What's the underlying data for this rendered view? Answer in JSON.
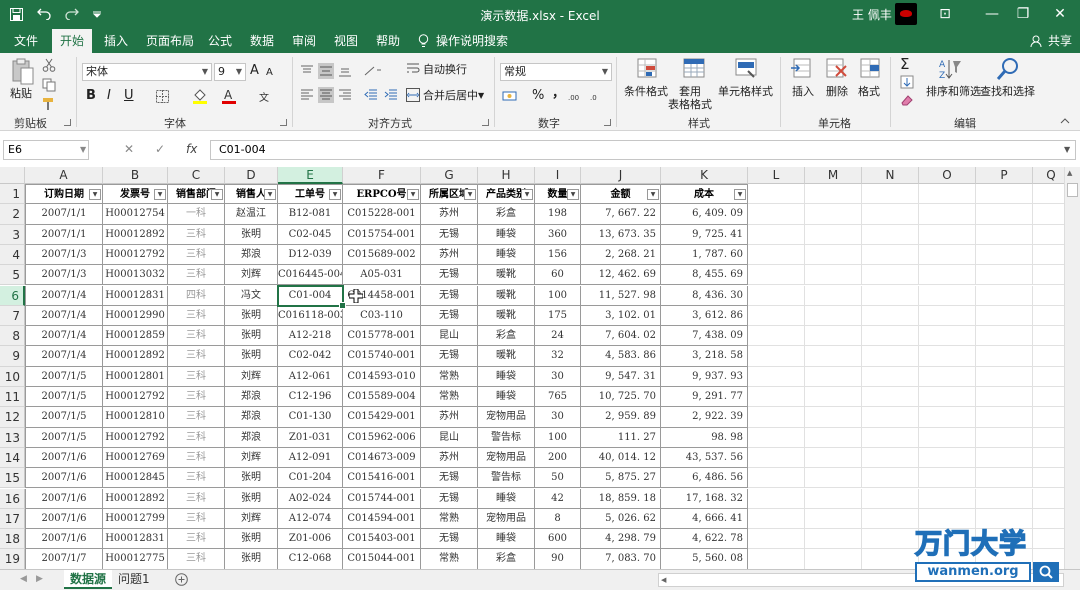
{
  "window": {
    "title": "演示数据.xlsx  -  Excel",
    "user": "王 佩丰",
    "buttons": {
      "restore_ribbon": "⊡",
      "minimize": "—",
      "maximize": "❐",
      "close": "✕"
    }
  },
  "qat": {
    "save_icon": "save-icon",
    "undo_icon": "undo-icon",
    "redo_icon": "redo-icon",
    "customize_icon": "qat-dropdown-icon"
  },
  "tabs": [
    {
      "label": "文件"
    },
    {
      "label": "开始"
    },
    {
      "label": "插入"
    },
    {
      "label": "页面布局"
    },
    {
      "label": "公式"
    },
    {
      "label": "数据"
    },
    {
      "label": "审阅"
    },
    {
      "label": "视图"
    },
    {
      "label": "帮助"
    }
  ],
  "tell_me": "操作说明搜索",
  "share": "共享",
  "ribbon": {
    "clipboard": {
      "label": "剪贴板",
      "paste": "粘贴"
    },
    "font": {
      "label": "字体",
      "name": "宋体",
      "size": "9",
      "bold": "B",
      "italic": "I",
      "underline": "U",
      "grow": "A",
      "shrink": "A"
    },
    "alignment": {
      "label": "对齐方式",
      "wrap": "自动换行",
      "merge": "合并后居中"
    },
    "number": {
      "label": "数字",
      "format": "常规",
      "percent": "%",
      "comma": "，"
    },
    "styles": {
      "label": "样式",
      "conditional": "条件格式",
      "table": "套用\n表格格式",
      "cell": "单元格样式"
    },
    "cells": {
      "label": "单元格",
      "insert": "插入",
      "delete": "删除",
      "format": "格式"
    },
    "editing": {
      "label": "编辑",
      "sort": "排序和筛选",
      "find": "查找和选择",
      "sum": "Σ"
    }
  },
  "formula_bar": {
    "name_box": "E6",
    "cancel": "✕",
    "enter": "✓",
    "fx": "fx",
    "value": "C01-004"
  },
  "columns": [
    "A",
    "B",
    "C",
    "D",
    "E",
    "F",
    "G",
    "H",
    "I",
    "J",
    "K",
    "L",
    "M",
    "N",
    "O",
    "P",
    "Q"
  ],
  "rows": [
    "1",
    "2",
    "3",
    "4",
    "5",
    "6",
    "7",
    "8",
    "9",
    "10",
    "11",
    "12",
    "13",
    "14",
    "15",
    "16",
    "17",
    "18",
    "19"
  ],
  "selected_cell": "E6",
  "table_headers": [
    "订购日期",
    "发票号",
    "销售部门",
    "销售人",
    "工单号",
    "ERPCO号",
    "所属区域",
    "产品类别",
    "数量",
    "金额",
    "成本"
  ],
  "table_rows": [
    [
      "2007/1/1",
      "H00012754",
      "一科",
      "赵温江",
      "B12-081",
      "C015228-001",
      "苏州",
      "彩盒",
      "198",
      "7, 667. 22",
      "6, 409. 09"
    ],
    [
      "2007/1/1",
      "H00012892",
      "三科",
      "张明",
      "C02-045",
      "C015754-001",
      "无锡",
      "睡袋",
      "360",
      "13, 673. 35",
      "9, 725. 41"
    ],
    [
      "2007/1/3",
      "H00012792",
      "三科",
      "郑浪",
      "D12-039",
      "C015689-002",
      "苏州",
      "睡袋",
      "156",
      "2, 268. 21",
      "1, 787. 60"
    ],
    [
      "2007/1/3",
      "H00013032",
      "三科",
      "刘辉",
      "C016445-004",
      "A05-031",
      "无锡",
      "暖靴",
      "60",
      "12, 462. 69",
      "8, 455. 69"
    ],
    [
      "2007/1/4",
      "H00012831",
      "四科",
      "冯文",
      "C01-004",
      "C014458-001",
      "无锡",
      "暖靴",
      "100",
      "11, 527. 98",
      "8, 436. 30"
    ],
    [
      "2007/1/4",
      "H00012990",
      "三科",
      "张明",
      "C016118-003",
      "C03-110",
      "无锡",
      "暖靴",
      "175",
      "3, 102. 01",
      "3, 612. 86"
    ],
    [
      "2007/1/4",
      "H00012859",
      "三科",
      "张明",
      "A12-218",
      "C015778-001",
      "昆山",
      "彩盒",
      "24",
      "7, 604. 02",
      "7, 438. 09"
    ],
    [
      "2007/1/4",
      "H00012892",
      "三科",
      "张明",
      "C02-042",
      "C015740-001",
      "无锡",
      "暖靴",
      "32",
      "4, 583. 86",
      "3, 218. 58"
    ],
    [
      "2007/1/5",
      "H00012801",
      "三科",
      "刘辉",
      "A12-061",
      "C014593-010",
      "常熟",
      "睡袋",
      "30",
      "9, 547. 31",
      "9, 937. 93"
    ],
    [
      "2007/1/5",
      "H00012792",
      "三科",
      "郑浪",
      "C12-196",
      "C015589-004",
      "常熟",
      "睡袋",
      "765",
      "10, 725. 70",
      "9, 291. 77"
    ],
    [
      "2007/1/5",
      "H00012810",
      "三科",
      "郑浪",
      "C01-130",
      "C015429-001",
      "苏州",
      "宠物用品",
      "30",
      "2, 959. 89",
      "2, 922. 39"
    ],
    [
      "2007/1/5",
      "H00012792",
      "三科",
      "郑浪",
      "Z01-031",
      "C015962-006",
      "昆山",
      "警告标",
      "100",
      "111. 27",
      "98. 98"
    ],
    [
      "2007/1/6",
      "H00012769",
      "三科",
      "刘辉",
      "A12-091",
      "C014673-009",
      "苏州",
      "宠物用品",
      "200",
      "40, 014. 12",
      "43, 537. 56"
    ],
    [
      "2007/1/6",
      "H00012845",
      "三科",
      "张明",
      "C01-204",
      "C015416-001",
      "无锡",
      "警告标",
      "50",
      "5, 875. 27",
      "6, 486. 56"
    ],
    [
      "2007/1/6",
      "H00012892",
      "三科",
      "张明",
      "A02-024",
      "C015744-001",
      "无锡",
      "睡袋",
      "42",
      "18, 859. 18",
      "17, 168. 32"
    ],
    [
      "2007/1/6",
      "H00012799",
      "三科",
      "刘辉",
      "A12-074",
      "C014594-001",
      "常熟",
      "宠物用品",
      "8",
      "5, 026. 62",
      "4, 666. 41"
    ],
    [
      "2007/1/6",
      "H00012831",
      "三科",
      "张明",
      "Z01-006",
      "C015403-001",
      "无锡",
      "睡袋",
      "600",
      "4, 298. 79",
      "4, 622. 78"
    ],
    [
      "2007/1/7",
      "H00012775",
      "三科",
      "张明",
      "C12-068",
      "C015044-001",
      "常熟",
      "彩盒",
      "90",
      "7, 083. 70",
      "5, 560. 08"
    ]
  ],
  "sheet_tabs": [
    {
      "label": "数据源"
    },
    {
      "label": "问题1"
    }
  ],
  "watermark": {
    "brand": "万门大学",
    "url": "wanmen.org"
  }
}
